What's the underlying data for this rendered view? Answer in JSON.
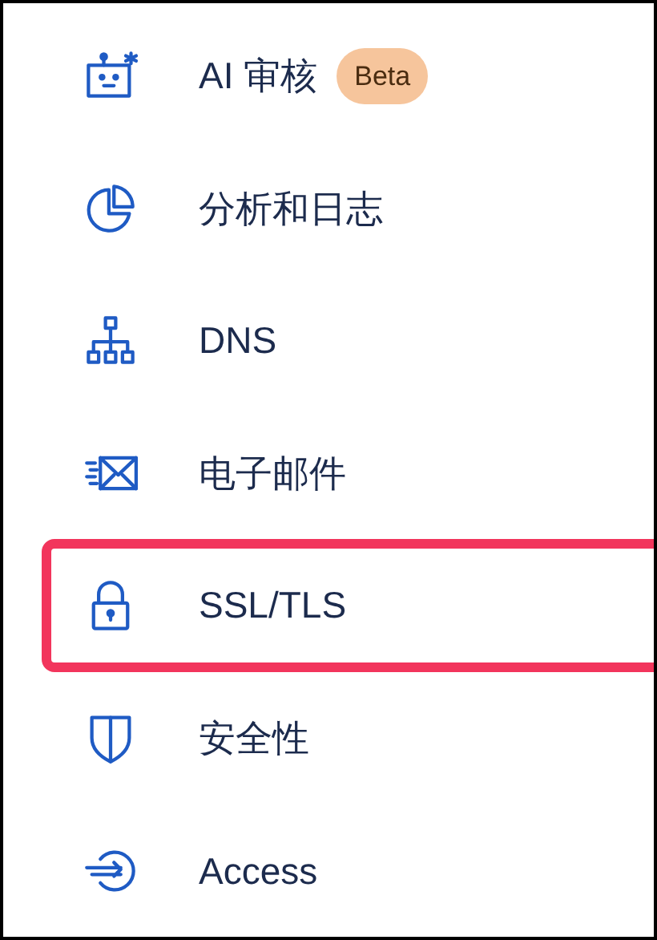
{
  "sidebar": {
    "items": [
      {
        "label": "AI 审核",
        "badge": "Beta",
        "highlighted": false
      },
      {
        "label": "分析和日志",
        "highlighted": false
      },
      {
        "label": "DNS",
        "highlighted": false
      },
      {
        "label": "电子邮件",
        "highlighted": false
      },
      {
        "label": "SSL/TLS",
        "highlighted": true
      },
      {
        "label": "安全性",
        "highlighted": false
      },
      {
        "label": "Access",
        "highlighted": false
      }
    ]
  }
}
